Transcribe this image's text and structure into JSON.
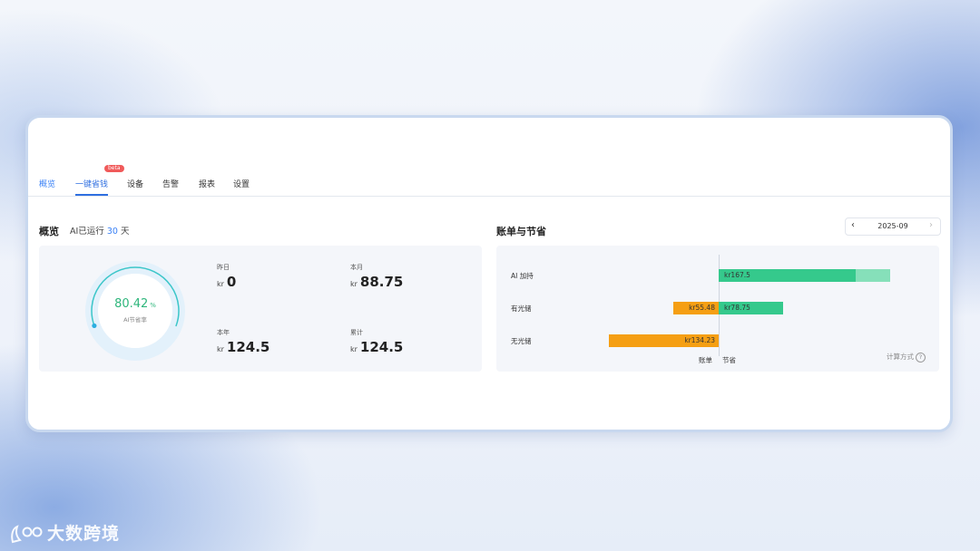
{
  "tabs": [
    {
      "label": "概览"
    },
    {
      "label": "一键省钱",
      "badge": "beta"
    },
    {
      "label": "设备"
    },
    {
      "label": "告警"
    },
    {
      "label": "报表"
    },
    {
      "label": "设置"
    }
  ],
  "overview": {
    "title": "概览",
    "runtime_prefix": "AI已运行",
    "runtime_days": "30",
    "runtime_suffix": "天",
    "gauge": {
      "value": "80.42",
      "unit": "%",
      "label": "AI节省率",
      "fraction": 0.8042
    },
    "stats": [
      {
        "label": "昨日",
        "currency": "kr",
        "value": "0"
      },
      {
        "label": "本月",
        "currency": "kr",
        "value": "88.75"
      },
      {
        "label": "本年",
        "currency": "kr",
        "value": "124.5"
      },
      {
        "label": "累计",
        "currency": "kr",
        "value": "124.5"
      }
    ]
  },
  "billing": {
    "title": "账单与节省",
    "date": "2025-09",
    "prev_icon": "chevron-left-icon",
    "next_icon": "chevron-right-icon",
    "axis_bill": "账单",
    "axis_save": "节省",
    "calc_method": "计算方式",
    "colors": {
      "bill": "#f59f13",
      "save": "#35c98c",
      "ai_extra": "#86e0ba"
    }
  },
  "chart_data": {
    "type": "bar",
    "categories": [
      "AI 加持",
      "有光储",
      "无光储"
    ],
    "series": [
      {
        "name": "账单",
        "values": [
          0,
          55.48,
          134.23
        ],
        "labels": [
          "",
          "kr55.48",
          "kr134.23"
        ]
      },
      {
        "name": "节省",
        "values": [
          167.5,
          78.75,
          0
        ],
        "labels": [
          "kr167.5",
          "kr78.75",
          ""
        ]
      }
    ],
    "ai_total_extent": 210
  },
  "watermark": {
    "text": "大数跨境"
  }
}
